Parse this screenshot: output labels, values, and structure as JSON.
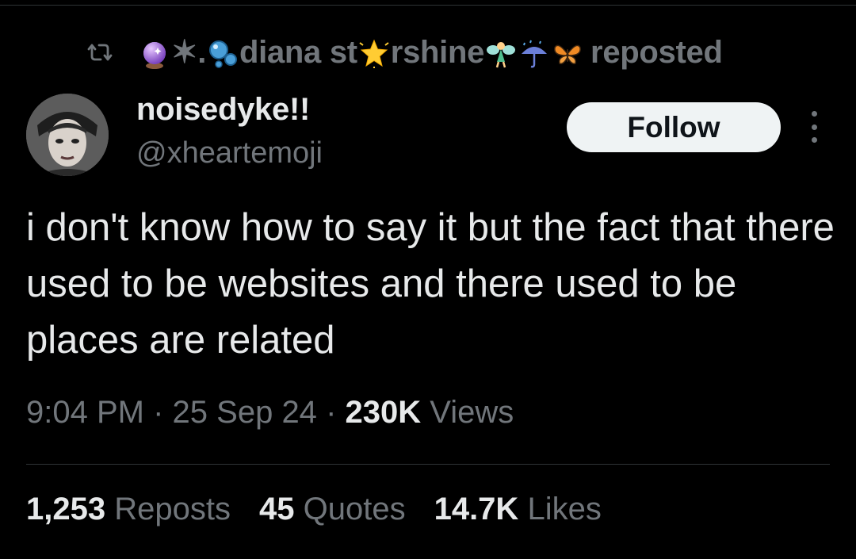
{
  "repost": {
    "icon": "repost-icon",
    "name_parts": [
      "✶.",
      "diana st",
      "rshine"
    ],
    "emojis": [
      "crystal-ball-icon",
      "bubbles-icon",
      "glowing-star-icon",
      "fairy-icon",
      "umbrella-rain-icon",
      "butterfly-icon"
    ],
    "label": "reposted"
  },
  "author": {
    "display_name": "noisedyke!!",
    "handle": "@xheartemoji",
    "avatar": "avatar"
  },
  "follow_label": "Follow",
  "tweet": {
    "text": "i don't know how to say it but the fact that there used to be websites and there used to be places are related"
  },
  "meta": {
    "time": "9:04 PM",
    "sep1": "·",
    "date": "25 Sep 24",
    "sep2": "·",
    "views_count": "230K",
    "views_label": "Views"
  },
  "stats": {
    "reposts_count": "1,253",
    "reposts_label": "Reposts",
    "quotes_count": "45",
    "quotes_label": "Quotes",
    "likes_count": "14.7K",
    "likes_label": "Likes"
  },
  "colors": {
    "background": "#000000",
    "primary_text": "#e7e9ea",
    "secondary_text": "#71767b",
    "follow_bg": "#eff3f4",
    "divider": "#2f3336"
  }
}
